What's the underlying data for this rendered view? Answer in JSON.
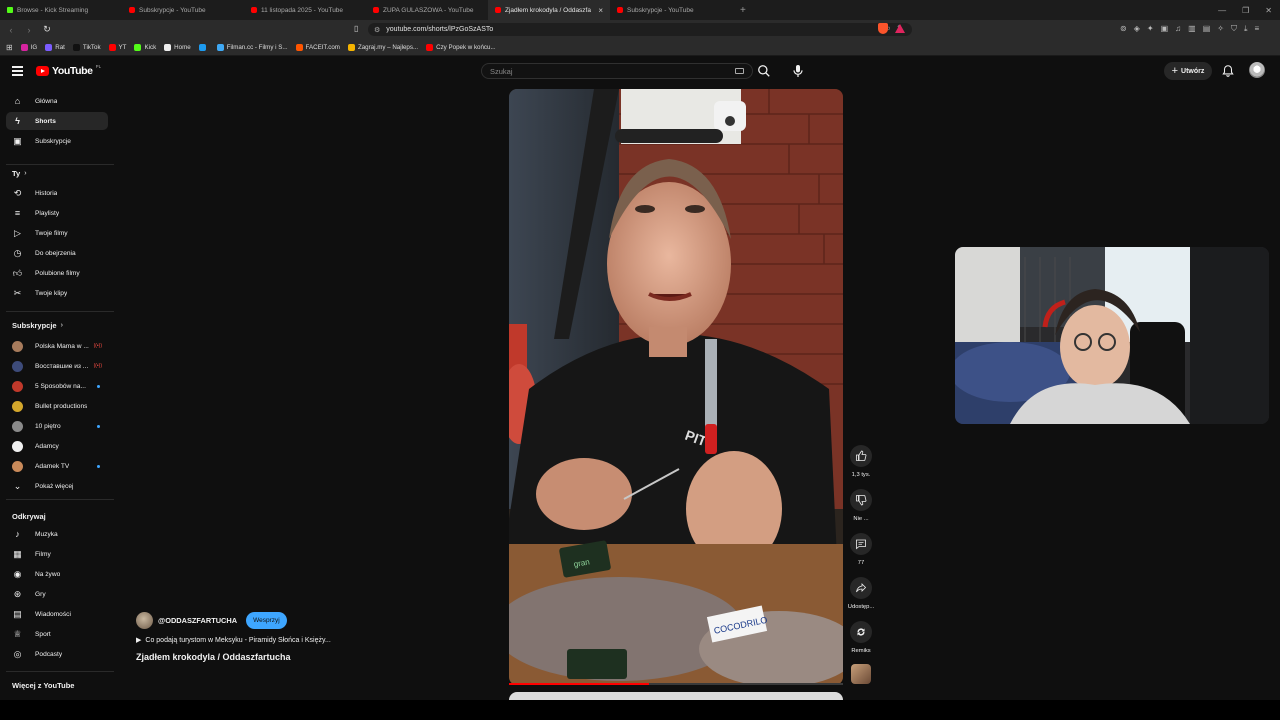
{
  "browser": {
    "tabs": [
      {
        "title": "Browse - Kick Streaming",
        "favicon": "kick"
      },
      {
        "title": "Subskrypcje - YouTube",
        "favicon": "yt"
      },
      {
        "title": "11 listopada 2025 - YouTube",
        "favicon": "yt"
      },
      {
        "title": "ZUPA GULASZOWA - YouTube",
        "favicon": "yt"
      },
      {
        "title": "Zjadłem krokodyla / Oddaszfa",
        "favicon": "yt",
        "active": true,
        "close": "×"
      },
      {
        "title": "Subskrypcje - YouTube",
        "favicon": "yt"
      }
    ],
    "new_tab": "+",
    "url": "youtube.com/shorts/lPzGoSzASTo",
    "bookmarks": [
      {
        "label": "IG",
        "color": "#d6249f"
      },
      {
        "label": "Rat",
        "color": "#7b5cff"
      },
      {
        "label": "TikTok",
        "color": "#111111"
      },
      {
        "label": "YT",
        "color": "#ff0000"
      },
      {
        "label": "Kick",
        "color": "#53fc18"
      },
      {
        "label": "Home",
        "color": "#eeeeee"
      },
      {
        "label": "",
        "color": "#1d9bf0"
      },
      {
        "label": "Filman.cc - Filmy i S...",
        "color": "#3fa9f5"
      },
      {
        "label": "FACEIT.com",
        "color": "#ff5500"
      },
      {
        "label": "Zagraj.my – Najleps...",
        "color": "#f5b400"
      },
      {
        "label": "Czy Popek w końcu...",
        "color": "#ff0000"
      }
    ]
  },
  "masthead": {
    "logo_text": "YouTube",
    "country_code": "PL",
    "search_placeholder": "Szukaj",
    "create_label": "Utwórz"
  },
  "sidebar": {
    "main": [
      {
        "label": "Główna",
        "icon": "home-icon"
      },
      {
        "label": "Shorts",
        "icon": "shorts-icon",
        "active": true
      },
      {
        "label": "Subskrypcje",
        "icon": "subscriptions-icon"
      }
    ],
    "you_header": "Ty",
    "you": [
      {
        "label": "Historia",
        "icon": "history-icon"
      },
      {
        "label": "Playlisty",
        "icon": "playlist-icon"
      },
      {
        "label": "Twoje filmy",
        "icon": "your-videos-icon"
      },
      {
        "label": "Do obejrzenia",
        "icon": "watch-later-icon"
      },
      {
        "label": "Polubione filmy",
        "icon": "liked-icon"
      },
      {
        "label": "Twoje klipy",
        "icon": "clips-icon"
      }
    ],
    "subs_header": "Subskrypcje",
    "subs": [
      {
        "label": "Polska Mama w ...",
        "color": "#a77b5c",
        "badge": "live"
      },
      {
        "label": "Восставшие из ...",
        "color": "#3d4b7a",
        "badge": "live"
      },
      {
        "label": "5 Sposobów na...",
        "color": "#c0392b",
        "badge": "dot"
      },
      {
        "label": "Bullet productions",
        "color": "#d4a72c",
        "badge": ""
      },
      {
        "label": "10 piętro",
        "color": "#8a8a8a",
        "badge": "dot"
      },
      {
        "label": "Adamcy",
        "color": "#f0f0f0",
        "badge": ""
      },
      {
        "label": "Adamek TV",
        "color": "#c98a5a",
        "badge": "dot"
      }
    ],
    "show_more": "Pokaż więcej",
    "explore_header": "Odkrywaj",
    "explore": [
      {
        "label": "Muzyka",
        "icon": "music-icon"
      },
      {
        "label": "Filmy",
        "icon": "movies-icon"
      },
      {
        "label": "Na żywo",
        "icon": "live-icon"
      },
      {
        "label": "Gry",
        "icon": "gaming-icon"
      },
      {
        "label": "Wiadomości",
        "icon": "news-icon"
      },
      {
        "label": "Sport",
        "icon": "trophy-icon"
      },
      {
        "label": "Podcasty",
        "icon": "podcast-icon"
      }
    ],
    "more_header": "Więcej z YouTube",
    "live_badge": "((•))"
  },
  "short": {
    "channel": "@ODDASZFARTUCHA",
    "support_label": "Wesprzyj",
    "playlist": "Co podają turystom w Meksyku - Piramidy Słońca i Księży...",
    "title": "Zjadłem krokodyla / Oddaszfartucha",
    "overlay_sign": "COCODRILO",
    "progress": 0.42,
    "likes": "1,3 tys.",
    "dislike_label": "Nie ...",
    "comments": "77",
    "share_label": "Udostęp...",
    "remix_label": "Remiks"
  }
}
